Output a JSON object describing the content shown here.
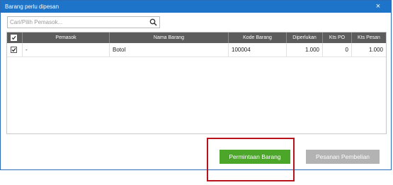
{
  "window": {
    "title": "Barang perlu dipesan",
    "close_glyph": "×"
  },
  "search": {
    "placeholder": "Cari/Pilih Pemasok...",
    "value": "",
    "icon": "search-icon"
  },
  "table": {
    "columns": [
      "Pemasok",
      "Nama Barang",
      "Kode Barang",
      "Diperlukan",
      "Kts PO",
      "Kts Pesan"
    ],
    "header_checked": true,
    "rows": [
      {
        "checked": true,
        "pemasok": "-",
        "nama_barang": "Botol",
        "kode_barang": "100004",
        "diperlukan": "1.000",
        "kts_po": "0",
        "kts_pesan": "1.000"
      }
    ]
  },
  "buttons": {
    "permintaan_barang": "Permintaan Barang",
    "pesanan_pembelian": "Pesanan Pembelian"
  },
  "colors": {
    "titlebar": "#1e74c9",
    "header": "#5c5c5c",
    "primary_button": "#4ca62a",
    "disabled_button": "#b3b3b3",
    "highlight": "#b8131c"
  }
}
